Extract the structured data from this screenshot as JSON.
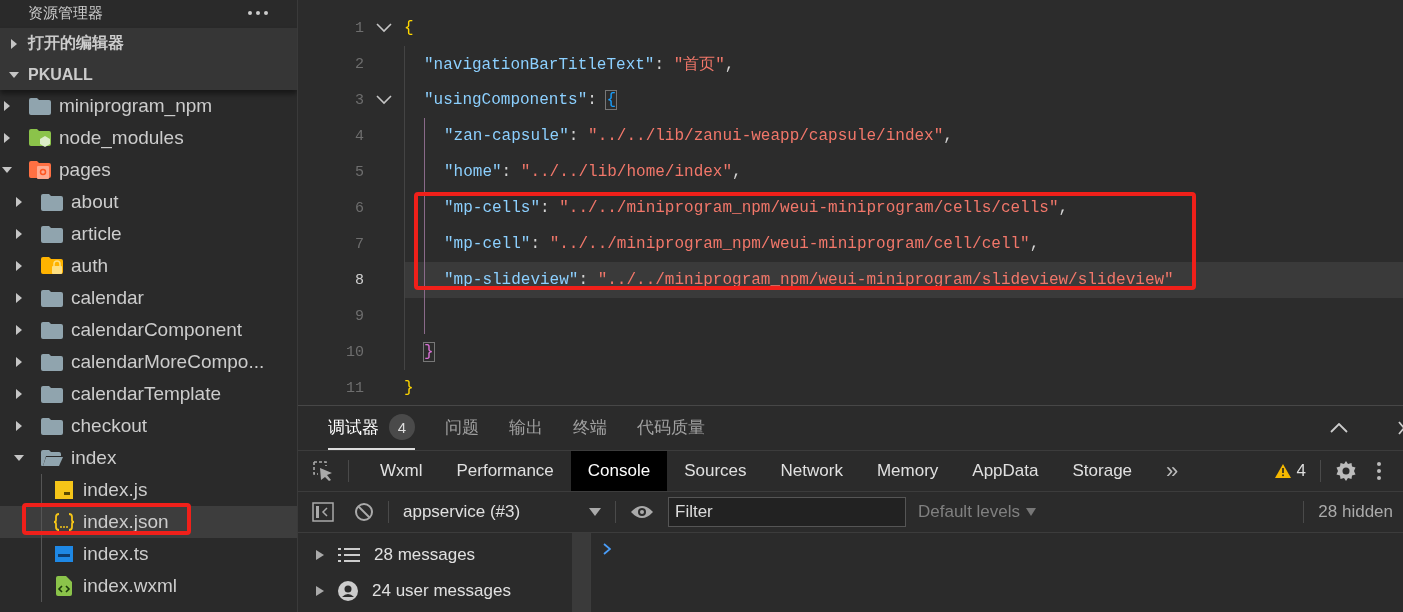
{
  "explorer": {
    "title": "资源管理器",
    "sections": [
      {
        "label": "打开的编辑器",
        "expanded": false
      },
      {
        "label": "PKUALL",
        "expanded": true
      }
    ],
    "tree": [
      {
        "label": "miniprogram_npm",
        "kind": "folder",
        "expanded": false,
        "selected": false
      },
      {
        "label": "node_modules",
        "kind": "folder-node",
        "expanded": false,
        "selected": false
      },
      {
        "label": "pages",
        "kind": "folder-pages",
        "expanded": true,
        "selected": false,
        "children": [
          {
            "label": "about",
            "kind": "folder",
            "expanded": false,
            "selected": false
          },
          {
            "label": "article",
            "kind": "folder",
            "expanded": false,
            "selected": false
          },
          {
            "label": "auth",
            "kind": "folder-lock",
            "expanded": false,
            "selected": false
          },
          {
            "label": "calendar",
            "kind": "folder",
            "expanded": false,
            "selected": false
          },
          {
            "label": "calendarComponent",
            "kind": "folder",
            "expanded": false,
            "selected": false
          },
          {
            "label": "calendarMoreCompo...",
            "kind": "folder",
            "expanded": false,
            "selected": false
          },
          {
            "label": "calendarTemplate",
            "kind": "folder",
            "expanded": false,
            "selected": false
          },
          {
            "label": "checkout",
            "kind": "folder",
            "expanded": false,
            "selected": false
          },
          {
            "label": "index",
            "kind": "folder",
            "expanded": true,
            "selected": false,
            "children": [
              {
                "label": "index.js",
                "kind": "file-js",
                "selected": false
              },
              {
                "label": "index.json",
                "kind": "file-json",
                "selected": true,
                "boxed": true
              },
              {
                "label": "index.ts",
                "kind": "file-ts",
                "selected": false
              },
              {
                "label": "index.wxml",
                "kind": "file-wxml",
                "selected": false
              }
            ]
          }
        ]
      }
    ]
  },
  "editor": {
    "lines": [
      {
        "number": "1",
        "expanded": true,
        "current": false,
        "tokens": [
          {
            "kind": "brace",
            "text": "{"
          }
        ],
        "children": [
          {
            "number": "2",
            "current": false,
            "tokens": [
              {
                "kind": "key",
                "text": "\"navigationBarTitleText\""
              },
              {
                "kind": "punct",
                "text": ": "
              },
              {
                "kind": "string",
                "text": "\"首页\""
              },
              {
                "kind": "punct",
                "text": ","
              }
            ]
          },
          {
            "number": "3",
            "expanded": true,
            "current": false,
            "tokens": [
              {
                "kind": "key",
                "text": "\"usingComponents\""
              },
              {
                "kind": "punct",
                "text": ": "
              },
              {
                "kind": "brace-match",
                "text": "{"
              }
            ],
            "children": [
              {
                "number": "4",
                "current": false,
                "tokens": [
                  {
                    "kind": "key",
                    "text": "\"zan-capsule\""
                  },
                  {
                    "kind": "punct",
                    "text": ": "
                  },
                  {
                    "kind": "string",
                    "text": "\"../../lib/zanui-weapp/capsule/index\""
                  },
                  {
                    "kind": "punct",
                    "text": ","
                  }
                ]
              },
              {
                "number": "5",
                "current": false,
                "tokens": [
                  {
                    "kind": "key",
                    "text": "\"home\""
                  },
                  {
                    "kind": "punct",
                    "text": ": "
                  },
                  {
                    "kind": "string",
                    "text": "\"../../lib/home/index\""
                  },
                  {
                    "kind": "punct",
                    "text": ","
                  }
                ]
              },
              {
                "number": "6",
                "current": false,
                "boxed": true,
                "tokens": [
                  {
                    "kind": "key",
                    "text": "\"mp-cells\""
                  },
                  {
                    "kind": "punct",
                    "text": ": "
                  },
                  {
                    "kind": "string",
                    "text": "\"../../miniprogram_npm/weui-miniprogram/cells/cells\""
                  },
                  {
                    "kind": "punct",
                    "text": ","
                  }
                ]
              },
              {
                "number": "7",
                "current": false,
                "boxed": true,
                "tokens": [
                  {
                    "kind": "key",
                    "text": "\"mp-cell\""
                  },
                  {
                    "kind": "punct",
                    "text": ": "
                  },
                  {
                    "kind": "string",
                    "text": "\"../../miniprogram_npm/weui-miniprogram/cell/cell\""
                  },
                  {
                    "kind": "punct",
                    "text": ","
                  }
                ]
              },
              {
                "number": "8",
                "current": true,
                "boxed": true,
                "tokens": [
                  {
                    "kind": "key",
                    "text": "\"mp-slideview\""
                  },
                  {
                    "kind": "punct",
                    "text": ": "
                  },
                  {
                    "kind": "string",
                    "text": "\"../../miniprogram_npm/weui-miniprogram/slideview/slideview\""
                  }
                ]
              },
              {
                "number": "9",
                "current": false
              }
            ]
          },
          {
            "number": "10",
            "current": false,
            "tokens": [
              {
                "kind": "brace-match",
                "text": "}"
              }
            ]
          }
        ]
      },
      {
        "number": "11",
        "current": false,
        "tokens": [
          {
            "kind": "brace",
            "text": "}"
          }
        ]
      }
    ]
  },
  "panel": {
    "tabs": [
      {
        "label": "调试器",
        "badge": "4",
        "selected": true
      },
      {
        "label": "问题",
        "selected": false
      },
      {
        "label": "输出",
        "selected": false
      },
      {
        "label": "终端",
        "selected": false
      },
      {
        "label": "代码质量",
        "selected": false
      }
    ]
  },
  "devtools": {
    "tabs": [
      {
        "label": "Wxml",
        "selected": false
      },
      {
        "label": "Performance",
        "selected": false
      },
      {
        "label": "Console",
        "selected": true
      },
      {
        "label": "Sources",
        "selected": false
      },
      {
        "label": "Network",
        "selected": false
      },
      {
        "label": "Memory",
        "selected": false
      },
      {
        "label": "AppData",
        "selected": false
      },
      {
        "label": "Storage",
        "selected": false
      }
    ],
    "overflow": "»",
    "warnings": "4"
  },
  "console_toolbar": {
    "context": "appservice (#3)",
    "filter": {
      "placeholder": "Filter"
    },
    "levels": "Default levels",
    "hidden": "28 hidden"
  },
  "console_sidebar": [
    {
      "label": "28 messages",
      "kind": "list"
    },
    {
      "label": "24 user messages",
      "kind": "user"
    }
  ]
}
